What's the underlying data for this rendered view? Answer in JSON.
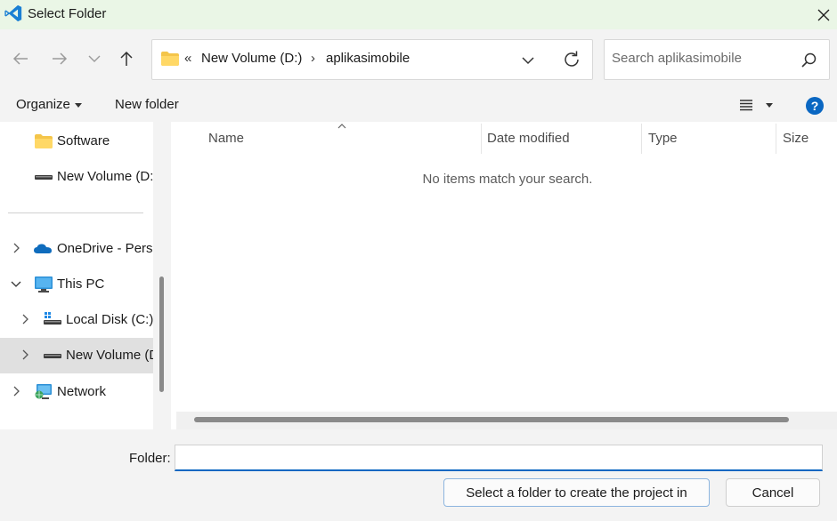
{
  "window": {
    "title": "Select Folder"
  },
  "address_bar": {
    "overflow_chevrons": "«",
    "crumbs": [
      "New Volume (D:)",
      "aplikasimobile"
    ],
    "separator": "›"
  },
  "search": {
    "placeholder": "Search aplikasimobile"
  },
  "command_bar": {
    "organize_label": "Organize",
    "new_folder_label": "New folder",
    "help_label": "?"
  },
  "nav_pane": {
    "quick_items": [
      {
        "label": "Software",
        "icon": "folder-icon"
      },
      {
        "label": "New Volume (D:",
        "icon": "drive-icon"
      }
    ],
    "tree_items": [
      {
        "label": "OneDrive - Perso",
        "icon": "onedrive-icon",
        "expanded": false
      },
      {
        "label": "This PC",
        "icon": "pc-icon",
        "expanded": true
      },
      {
        "label": "Local Disk (C:)",
        "icon": "system-drive-icon",
        "expanded": false
      },
      {
        "label": "New Volume (D",
        "icon": "drive-icon",
        "expanded": false,
        "selected": true
      },
      {
        "label": "Network",
        "icon": "network-icon",
        "expanded": false
      }
    ]
  },
  "file_list": {
    "columns": [
      "Name",
      "Date modified",
      "Type",
      "Size"
    ],
    "empty_message": "No items match your search."
  },
  "footer": {
    "folder_label": "Folder:",
    "folder_value": "",
    "select_button": "Select a folder to create the project in",
    "cancel_button": "Cancel"
  },
  "colors": {
    "titlebar_bg": "#eaf6e6",
    "accent": "#0a67c2",
    "selected_row": "#e0e0e0",
    "folder_yellow": "#f4c54a"
  }
}
